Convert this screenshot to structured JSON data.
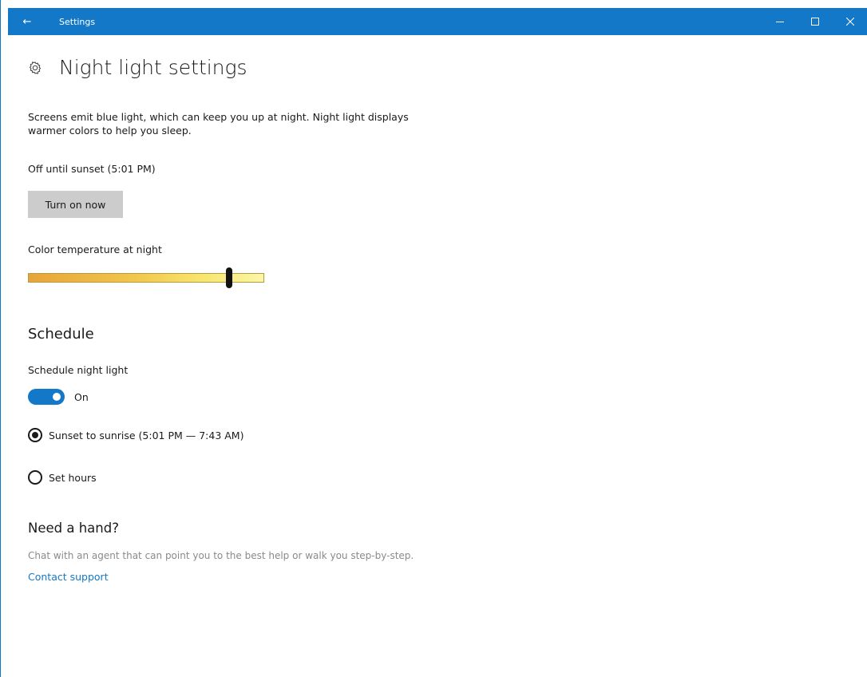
{
  "window": {
    "title": "Settings",
    "accent_color": "#1478c8",
    "icons": {
      "back": "back-arrow-icon",
      "minimize": "minimize-icon",
      "maximize": "maximize-icon",
      "close": "close-icon"
    }
  },
  "page": {
    "icon": "gear-icon",
    "title": "Night light settings",
    "description": "Screens emit blue light, which can keep you up at night. Night light displays warmer colors to help you sleep.",
    "status": "Off until sunset (5:01 PM)",
    "turn_on_button": "Turn on now"
  },
  "color_temperature": {
    "label": "Color temperature at night",
    "value_fraction": 0.85
  },
  "schedule": {
    "title": "Schedule",
    "toggle_label": "Schedule night light",
    "toggle_state": "On",
    "options": [
      {
        "label": "Sunset to sunrise (5:01 PM — 7:43 AM)",
        "selected": true
      },
      {
        "label": "Set hours",
        "selected": false
      }
    ]
  },
  "help": {
    "title": "Need a hand?",
    "description": "Chat with an agent that can point you to the best help or walk you step-by-step.",
    "link": "Contact support"
  }
}
